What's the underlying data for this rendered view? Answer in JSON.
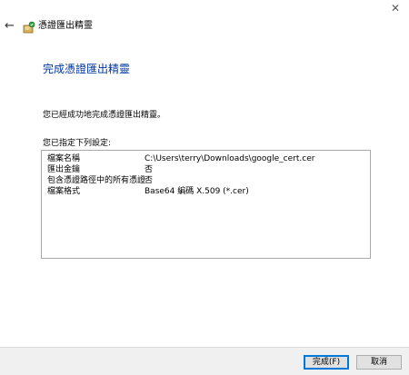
{
  "window": {
    "close_glyph": "✕",
    "back_glyph": "←",
    "icon": "certificate-wizard-icon",
    "title": "憑證匯出精靈"
  },
  "main": {
    "heading": "完成憑證匯出精靈",
    "message": "您已經成功地完成憑證匯出精靈。",
    "settings_label": "您已指定下列設定:",
    "settings": [
      {
        "key": "檔案名稱",
        "value": "C:\\Users\\terry\\Downloads\\google_cert.cer"
      },
      {
        "key": "匯出金鑰",
        "value": "否"
      },
      {
        "key": "包含憑證路徑中的所有憑證",
        "value": "否"
      },
      {
        "key": "檔案格式",
        "value": "Base64 編碼 X.509 (*.cer)"
      }
    ]
  },
  "footer": {
    "finish_label": "完成(F)",
    "cancel_label": "取消"
  },
  "colors": {
    "heading": "#00349a",
    "primary_border": "#0078d7",
    "footer_bg": "#f0f0f0"
  }
}
